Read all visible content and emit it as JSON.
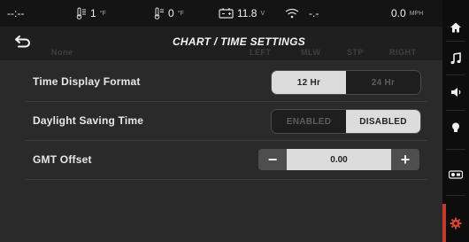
{
  "status_bar": {
    "left_readout": "--:--",
    "fresh_temp": {
      "value": "1",
      "unit": "°F"
    },
    "gray_temp": {
      "value": "0",
      "unit": "°F"
    },
    "battery": {
      "value": "11.8",
      "unit": "V"
    },
    "signal_readout": "-.-",
    "speed": {
      "value": "0.0",
      "unit": "MPH"
    }
  },
  "header": {
    "title": "CHART / TIME SETTINGS",
    "ghost_labels": [
      "None",
      "LEFT",
      "MLW",
      "STP",
      "RIGHT"
    ]
  },
  "settings": {
    "time_format": {
      "label": "Time Display Format",
      "options": [
        "12 Hr",
        "24 Hr"
      ],
      "selected": "12 Hr"
    },
    "dst": {
      "label": "Daylight Saving Time",
      "options": [
        "ENABLED",
        "DISABLED"
      ],
      "selected": "DISABLED"
    },
    "gmt": {
      "label": "GMT Offset",
      "value": "0.00",
      "decrement": "−",
      "increment": "+"
    }
  },
  "sidebar": {
    "items": [
      "home-icon",
      "music-icon",
      "speaker-icon",
      "light-bulb-icon",
      "controls-icon",
      "settings-gear-icon"
    ],
    "active": "settings-gear-icon",
    "accent": "#c0392b"
  }
}
